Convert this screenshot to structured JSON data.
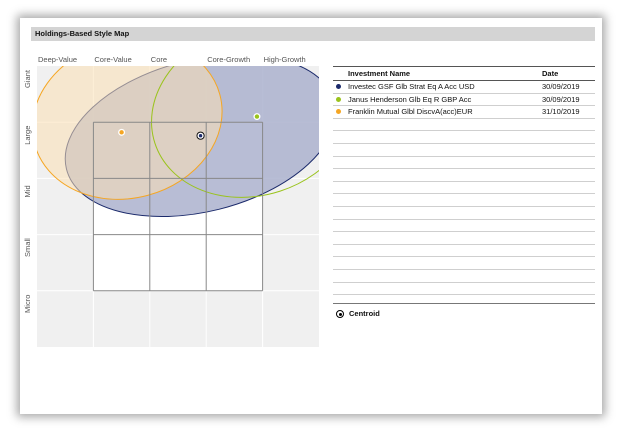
{
  "title": "Holdings-Based Style Map",
  "chart_data": {
    "type": "scatter",
    "title": "Holdings-Based Style Map",
    "x_categories": [
      "Deep-Value",
      "Core-Value",
      "Core",
      "Core-Growth",
      "High-Growth"
    ],
    "y_categories": [
      "Giant",
      "Large",
      "Mid",
      "Small",
      "Micro"
    ],
    "xlim": [
      0,
      5
    ],
    "ylim": [
      0,
      5
    ],
    "style_box": {
      "x": [
        1,
        4
      ],
      "y": [
        1,
        4
      ]
    },
    "series": [
      {
        "name": "Investec GSF Glb Strat Eq A Acc USD",
        "date": "30/09/2019",
        "color": "#1b2a6b",
        "point": [
          2.9,
          3.76
        ],
        "ellipse": {
          "center": [
            2.9,
            3.76
          ],
          "rx": 2.45,
          "ry": 1.35,
          "rotation": -14
        }
      },
      {
        "name": "Janus Henderson Glb Eq R GBP Acc",
        "date": "30/09/2019",
        "color": "#9ac31c",
        "point": [
          3.9,
          4.1
        ],
        "ellipse": {
          "center": [
            3.85,
            4.2
          ],
          "rx": 1.85,
          "ry": 1.5,
          "rotation": -18
        }
      },
      {
        "name": "Franklin Mutual Glbl DiscvA(acc)EUR",
        "date": "31/10/2019",
        "color": "#f5a623",
        "point": [
          1.5,
          3.82
        ],
        "ellipse": {
          "center": [
            1.6,
            4.05
          ],
          "rx": 1.7,
          "ry": 1.4,
          "rotation": -15
        }
      }
    ],
    "centroid_label": "Centroid"
  },
  "table": {
    "headers": {
      "name": "Investment Name",
      "date": "Date"
    },
    "empty_rows": 14
  }
}
